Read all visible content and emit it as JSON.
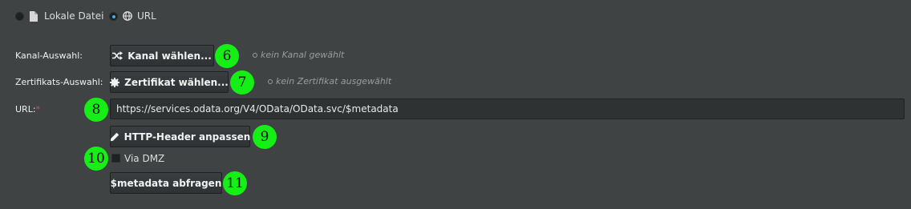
{
  "source": {
    "local_label": "Lokale Datei",
    "local_selected": false,
    "url_label": "URL",
    "url_selected": true
  },
  "channel": {
    "label": "Kanal-Auswahl:",
    "button_label": "Kanal wählen...",
    "status": "kein Kanal gewählt",
    "badge": "6"
  },
  "certificate": {
    "label": "Zertifikats-Auswahl:",
    "button_label": "Zertifikat wählen...",
    "status": "kein Zertifikat ausgewählt",
    "badge": "7"
  },
  "url": {
    "label": "URL:",
    "required_mark": "*",
    "value": "https://services.odata.org/V4/OData/OData.svc/$metadata",
    "badge": "8"
  },
  "http_header": {
    "button_label": "HTTP-Header anpassen",
    "badge": "9"
  },
  "dmz": {
    "label": "Via DMZ",
    "checked": false,
    "badge": "10"
  },
  "metadata": {
    "button_label": "$metadata abfragen",
    "badge": "11"
  },
  "colors": {
    "background": "#404344",
    "badge": "#16ef16",
    "radio_selected": "#4aa9e6",
    "required": "#e04a3c"
  }
}
